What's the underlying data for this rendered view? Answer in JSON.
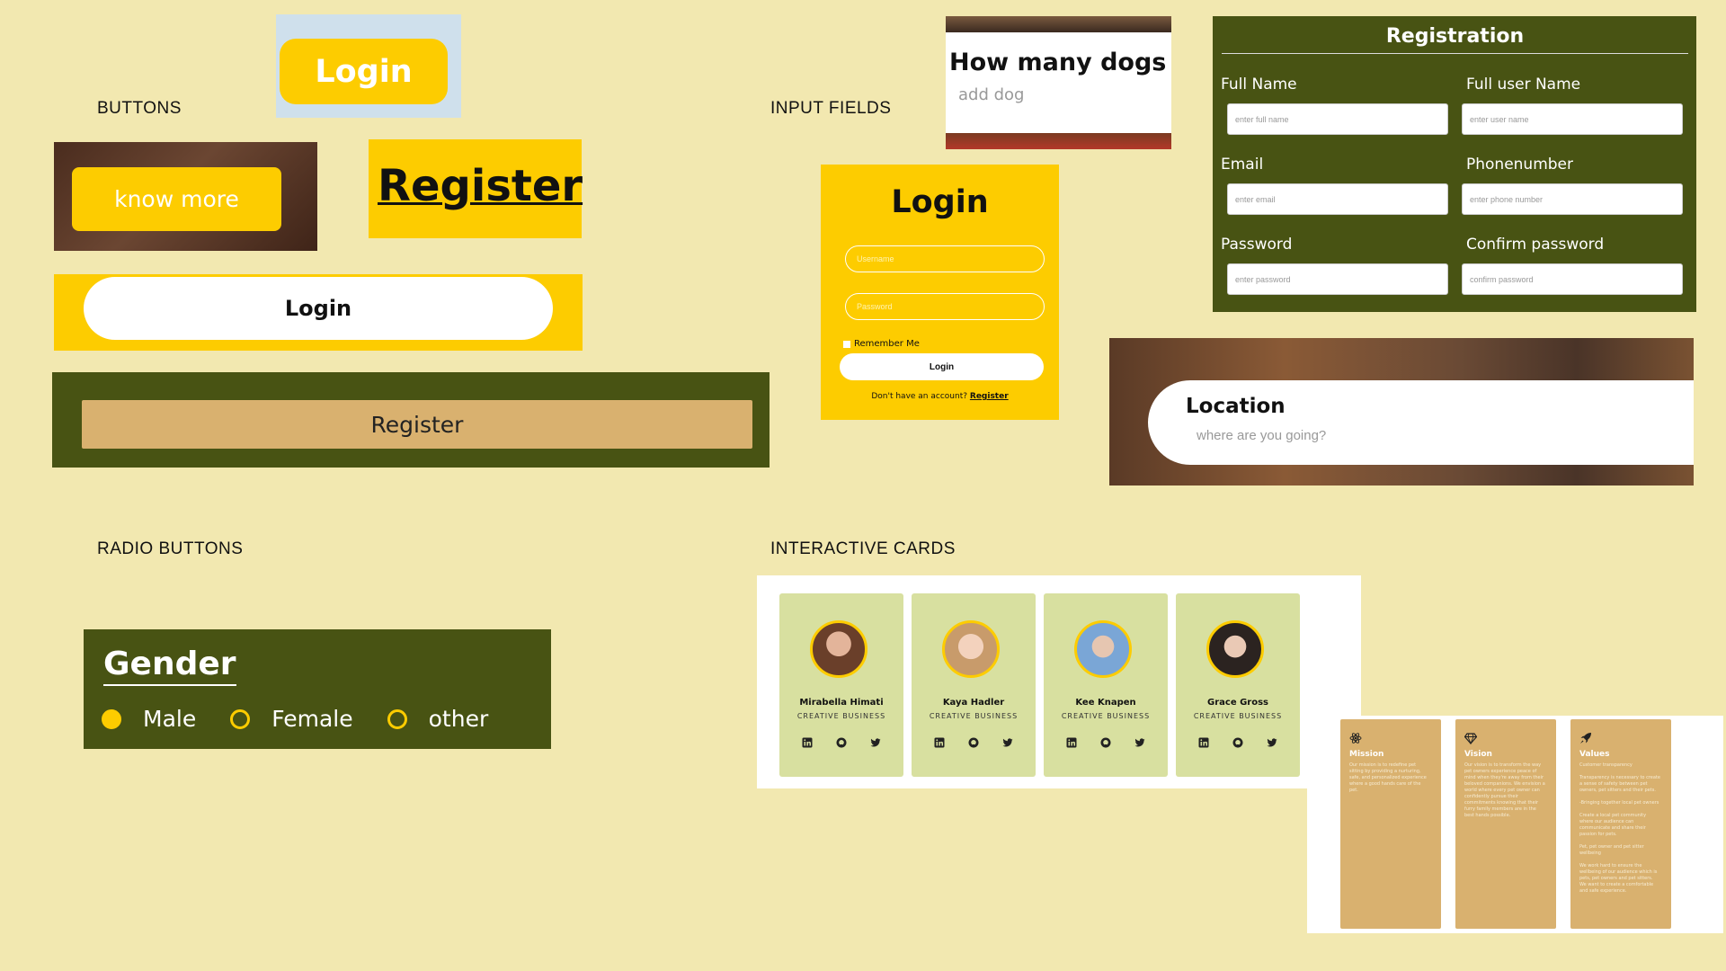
{
  "sections": {
    "buttons": "BUTTONS",
    "input_fields": "INPUT FIELDS",
    "radio_buttons": "RADIO BUTTONS",
    "interactive_cards": "INTERACTIVE CARDS"
  },
  "buttons": {
    "login_yellow": "Login",
    "know_more": "know more",
    "register_link": "Register",
    "login_white": "Login",
    "register_tan": "Register"
  },
  "radio": {
    "title": "Gender",
    "options": [
      {
        "label": "Male",
        "checked": true
      },
      {
        "label": "Female",
        "checked": false
      },
      {
        "label": "other",
        "checked": false
      }
    ]
  },
  "dogs_field": {
    "title": "How many dogs",
    "placeholder": "add dog"
  },
  "login_card": {
    "title": "Login",
    "username_placeholder": "Username",
    "password_placeholder": "Password",
    "remember": "Remember Me",
    "button": "Login",
    "footer_text": "Don't have an account?",
    "footer_link": "Register"
  },
  "registration": {
    "title": "Registration",
    "fields": [
      {
        "label": "Full Name",
        "placeholder": "enter full name"
      },
      {
        "label": "Full user Name",
        "placeholder": "enter user name"
      },
      {
        "label": "Email",
        "placeholder": "enter email"
      },
      {
        "label": "Phonenumber",
        "placeholder": "enter phone number"
      },
      {
        "label": "Password",
        "placeholder": "enter password"
      },
      {
        "label": "Confirm password",
        "placeholder": "confirm password"
      }
    ]
  },
  "location": {
    "title": "Location",
    "placeholder": "where are you going?"
  },
  "profiles": [
    {
      "name": "Mirabella Himati",
      "role": "CREATIVE BUSINESS"
    },
    {
      "name": "Kaya Hadler",
      "role": "CREATIVE BUSINESS"
    },
    {
      "name": "Kee Knapen",
      "role": "CREATIVE BUSINESS"
    },
    {
      "name": "Grace Gross",
      "role": "CREATIVE BUSINESS"
    }
  ],
  "mvv": [
    {
      "title": "Mission",
      "icon": "atom-icon",
      "text": "Our mission is to redefine pet sitting by providing a nurturing, safe, and personalized experience where a good hands care of the pet."
    },
    {
      "title": "Vision",
      "icon": "diamond-icon",
      "text": "Our vision is to transform the way pet owners experience peace of mind when they're away from their beloved companions. We envision a world where every pet owner can confidently pursue their commitments knowing that their furry family members are in the best hands possible."
    },
    {
      "title": "Values",
      "icon": "rocket-icon",
      "text": "Customer transparency\n\nTransparency is necessary to create a sense of safety between pet owners, pet sitters and their pets.\n\n-Bringing together local pet owners\n\nCreate a local pet community where our audience can communicate and share their passion for pets.\n\nPet, pet owner and pet sitter wellbeing\n\nWe work hard to ensure the wellbeing of our audience which is pets, pet owners and pet sitters. We want to create a comfortable and safe experience."
    }
  ],
  "colors": {
    "background": "#f2e8b0",
    "yellow": "#fdcc00",
    "olive": "#485313",
    "tan": "#d9b16f",
    "card_green": "#d8e0a0"
  }
}
